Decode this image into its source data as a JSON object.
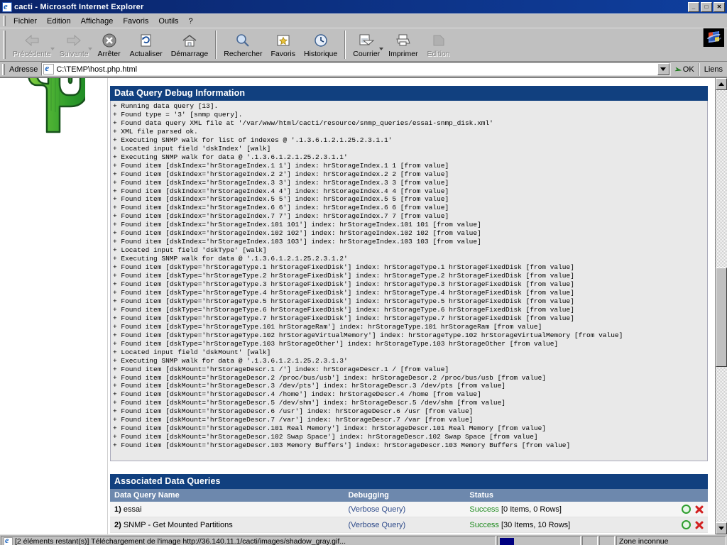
{
  "window": {
    "title": "cacti - Microsoft Internet Explorer",
    "icon": "ie-document-icon",
    "minimize": "_",
    "maximize": "□",
    "close": "✕"
  },
  "menu": [
    {
      "label": "Fichier",
      "mnemonic": "F"
    },
    {
      "label": "Edition",
      "mnemonic": "E"
    },
    {
      "label": "Affichage",
      "mnemonic": "A"
    },
    {
      "label": "Favoris",
      "mnemonic": "v"
    },
    {
      "label": "Outils",
      "mnemonic": "O"
    },
    {
      "label": "?",
      "mnemonic": ""
    }
  ],
  "toolbar": [
    {
      "label": "Précédente",
      "icon": "back-arrow-icon",
      "disabled": true,
      "dropdown": true
    },
    {
      "label": "Suivante",
      "icon": "forward-arrow-icon",
      "disabled": true,
      "dropdown": true
    },
    {
      "label": "Arrêter",
      "icon": "stop-icon",
      "disabled": false,
      "dropdown": false
    },
    {
      "label": "Actualiser",
      "icon": "refresh-icon",
      "disabled": false,
      "dropdown": false
    },
    {
      "label": "Démarrage",
      "icon": "home-icon",
      "disabled": false,
      "dropdown": false
    },
    {
      "label": "Rechercher",
      "icon": "search-icon",
      "disabled": false,
      "dropdown": false
    },
    {
      "label": "Favoris",
      "icon": "favorites-star-icon",
      "disabled": false,
      "dropdown": false
    },
    {
      "label": "Historique",
      "icon": "history-clock-icon",
      "disabled": false,
      "dropdown": false
    },
    {
      "label": "Courrier",
      "icon": "mail-icon",
      "disabled": false,
      "dropdown": true
    },
    {
      "label": "Imprimer",
      "icon": "printer-icon",
      "disabled": false,
      "dropdown": false
    },
    {
      "label": "Edition",
      "icon": "edit-page-icon",
      "disabled": true,
      "dropdown": false
    }
  ],
  "address": {
    "label": "Adresse",
    "value": "C:\\TEMP\\host.php.html",
    "placeholder": "",
    "go_label": "OK",
    "links_label": "Liens"
  },
  "page": {
    "debug_panel": {
      "title": "Data Query Debug Information",
      "lines": [
        "+ Running data query [13].",
        "+ Found type = '3' [snmp query].",
        "+ Found data query XML file at '/var/www/html/cacti/resource/snmp_queries/essai-snmp_disk.xml'",
        "+ XML file parsed ok.",
        "+ Executing SNMP walk for list of indexes @ '.1.3.6.1.2.1.25.2.3.1.1'",
        "+ Located input field 'dskIndex' [walk]",
        "+ Executing SNMP walk for data @ '.1.3.6.1.2.1.25.2.3.1.1'",
        "+ Found item [dskIndex='hrStorageIndex.1 1'] index: hrStorageIndex.1 1 [from value]",
        "+ Found item [dskIndex='hrStorageIndex.2 2'] index: hrStorageIndex.2 2 [from value]",
        "+ Found item [dskIndex='hrStorageIndex.3 3'] index: hrStorageIndex.3 3 [from value]",
        "+ Found item [dskIndex='hrStorageIndex.4 4'] index: hrStorageIndex.4 4 [from value]",
        "+ Found item [dskIndex='hrStorageIndex.5 5'] index: hrStorageIndex.5 5 [from value]",
        "+ Found item [dskIndex='hrStorageIndex.6 6'] index: hrStorageIndex.6 6 [from value]",
        "+ Found item [dskIndex='hrStorageIndex.7 7'] index: hrStorageIndex.7 7 [from value]",
        "+ Found item [dskIndex='hrStorageIndex.101 101'] index: hrStorageIndex.101 101 [from value]",
        "+ Found item [dskIndex='hrStorageIndex.102 102'] index: hrStorageIndex.102 102 [from value]",
        "+ Found item [dskIndex='hrStorageIndex.103 103'] index: hrStorageIndex.103 103 [from value]",
        "+ Located input field 'dskType' [walk]",
        "+ Executing SNMP walk for data @ '.1.3.6.1.2.1.25.2.3.1.2'",
        "+ Found item [dskType='hrStorageType.1 hrStorageFixedDisk'] index: hrStorageType.1 hrStorageFixedDisk [from value]",
        "+ Found item [dskType='hrStorageType.2 hrStorageFixedDisk'] index: hrStorageType.2 hrStorageFixedDisk [from value]",
        "+ Found item [dskType='hrStorageType.3 hrStorageFixedDisk'] index: hrStorageType.3 hrStorageFixedDisk [from value]",
        "+ Found item [dskType='hrStorageType.4 hrStorageFixedDisk'] index: hrStorageType.4 hrStorageFixedDisk [from value]",
        "+ Found item [dskType='hrStorageType.5 hrStorageFixedDisk'] index: hrStorageType.5 hrStorageFixedDisk [from value]",
        "+ Found item [dskType='hrStorageType.6 hrStorageFixedDisk'] index: hrStorageType.6 hrStorageFixedDisk [from value]",
        "+ Found item [dskType='hrStorageType.7 hrStorageFixedDisk'] index: hrStorageType.7 hrStorageFixedDisk [from value]",
        "+ Found item [dskType='hrStorageType.101 hrStorageRam'] index: hrStorageType.101 hrStorageRam [from value]",
        "+ Found item [dskType='hrStorageType.102 hrStorageVirtualMemory'] index: hrStorageType.102 hrStorageVirtualMemory [from value]",
        "+ Found item [dskType='hrStorageType.103 hrStorageOther'] index: hrStorageType.103 hrStorageOther [from value]",
        "+ Located input field 'dskMount' [walk]",
        "+ Executing SNMP walk for data @ '.1.3.6.1.2.1.25.2.3.1.3'",
        "+ Found item [dskMount='hrStorageDescr.1 /'] index: hrStorageDescr.1 / [from value]",
        "+ Found item [dskMount='hrStorageDescr.2 /proc/bus/usb'] index: hrStorageDescr.2 /proc/bus/usb [from value]",
        "+ Found item [dskMount='hrStorageDescr.3 /dev/pts'] index: hrStorageDescr.3 /dev/pts [from value]",
        "+ Found item [dskMount='hrStorageDescr.4 /home'] index: hrStorageDescr.4 /home [from value]",
        "+ Found item [dskMount='hrStorageDescr.5 /dev/shm'] index: hrStorageDescr.5 /dev/shm [from value]",
        "+ Found item [dskMount='hrStorageDescr.6 /usr'] index: hrStorageDescr.6 /usr [from value]",
        "+ Found item [dskMount='hrStorageDescr.7 /var'] index: hrStorageDescr.7 /var [from value]",
        "+ Found item [dskMount='hrStorageDescr.101 Real Memory'] index: hrStorageDescr.101 Real Memory [from value]",
        "+ Found item [dskMount='hrStorageDescr.102 Swap Space'] index: hrStorageDescr.102 Swap Space [from value]",
        "+ Found item [dskMount='hrStorageDescr.103 Memory Buffers'] index: hrStorageDescr.103 Memory Buffers [from value]"
      ]
    },
    "queries_panel": {
      "title": "Associated Data Queries",
      "columns": [
        "Data Query Name",
        "Debugging",
        "Status"
      ],
      "rows": [
        {
          "num": "1)",
          "name": "essai",
          "debug_link": "(Verbose Query)",
          "status_word": "Success",
          "status_detail": "[0 Items, 0 Rows]"
        },
        {
          "num": "2)",
          "name": "SNMP - Get Mounted Partitions",
          "debug_link": "(Verbose Query)",
          "status_word": "Success",
          "status_detail": "[30 Items, 10 Rows]"
        }
      ],
      "row_actions": {
        "reload": "reload-icon",
        "delete": "delete-icon"
      }
    },
    "logo": "cacti-cactus-logo"
  },
  "statusbar": {
    "message": "[2 éléments restant(s)] Téléchargement de l'image http://36.140.11.1/cacti/images/shadow_gray.gif...",
    "zone": "Zone inconnue"
  },
  "colors": {
    "panel_header": "#11407F",
    "table_header": "#6D88AD",
    "success": "#1F8B1F",
    "link": "#2D4A8A",
    "chrome": "#C0C0C0",
    "titlebar": "#0A246A"
  }
}
